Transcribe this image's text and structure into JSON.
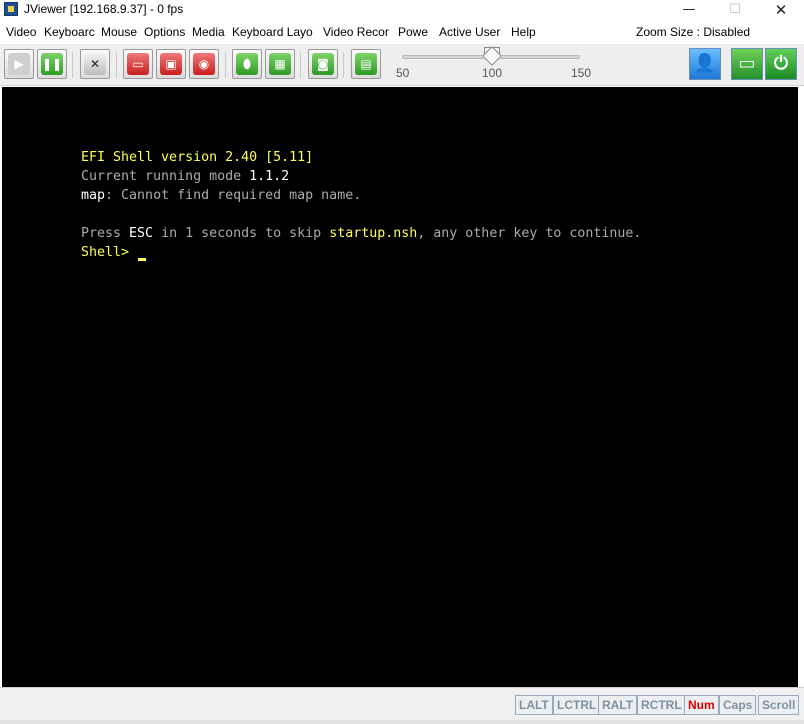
{
  "window": {
    "title": "JViewer [192.168.9.37] - 0 fps",
    "minimize": "—",
    "maximize": "☐",
    "close": "✕"
  },
  "menu": {
    "items": [
      {
        "label": "Video"
      },
      {
        "label": "Keyboarc"
      },
      {
        "label": "Mouse"
      },
      {
        "label": "Options"
      },
      {
        "label": "Media"
      },
      {
        "label": "Keyboard Layo"
      },
      {
        "label": "Video Recor"
      },
      {
        "label": "Powe"
      },
      {
        "label": "Active User"
      },
      {
        "label": "Help"
      }
    ],
    "zoom_status": "Zoom Size : Disabled"
  },
  "toolbar": {
    "zoom_slider": {
      "min_label": "50",
      "mid_label": "100",
      "max_label": "150",
      "value": 100
    },
    "buttons": [
      {
        "name": "play",
        "icon": "play-icon"
      },
      {
        "name": "pause",
        "icon": "pause-icon"
      },
      {
        "name": "fullscreen",
        "icon": "fullscreen-icon"
      },
      {
        "name": "cdrom-redirect",
        "icon": "cd-icon"
      },
      {
        "name": "floppy-redirect",
        "icon": "floppy-icon"
      },
      {
        "name": "harddisk-redirect",
        "icon": "harddisk-icon"
      },
      {
        "name": "mouse",
        "icon": "mouse-icon"
      },
      {
        "name": "keyboard",
        "icon": "keyboard-icon"
      },
      {
        "name": "video-record",
        "icon": "video-record-icon"
      },
      {
        "name": "hotkeys",
        "icon": "hotkeys-icon"
      }
    ],
    "right_buttons": [
      {
        "name": "active-users",
        "icon": "user-icon"
      },
      {
        "name": "host-display",
        "icon": "monitor-icon"
      },
      {
        "name": "power",
        "icon": "power-icon"
      }
    ]
  },
  "console": {
    "lines": {
      "l1": "EFI Shell version 2.40 [5.11]",
      "l2a": "Current running mode ",
      "l2b": "1.1.2",
      "l3a": "map",
      "l3b": ": Cannot find required map name.",
      "l4a": "Press ",
      "l4b": "ESC",
      "l4c": " in 1 seconds to skip ",
      "l4d": "startup.nsh",
      "l4e": ", any other key to continue.",
      "l5": "Shell>"
    },
    "colors": {
      "yellow": "#ffff55",
      "grey": "#aaaaaa",
      "white": "#ffffff",
      "background": "#000000"
    }
  },
  "statusbar": {
    "keys": [
      {
        "label": "LALT",
        "active": false
      },
      {
        "label": "LCTRL",
        "active": false
      },
      {
        "label": "RALT",
        "active": false
      },
      {
        "label": "RCTRL",
        "active": false
      },
      {
        "label": "Num",
        "active": true
      },
      {
        "label": "Caps",
        "active": false
      },
      {
        "label": "Scroll",
        "active": false
      }
    ]
  }
}
